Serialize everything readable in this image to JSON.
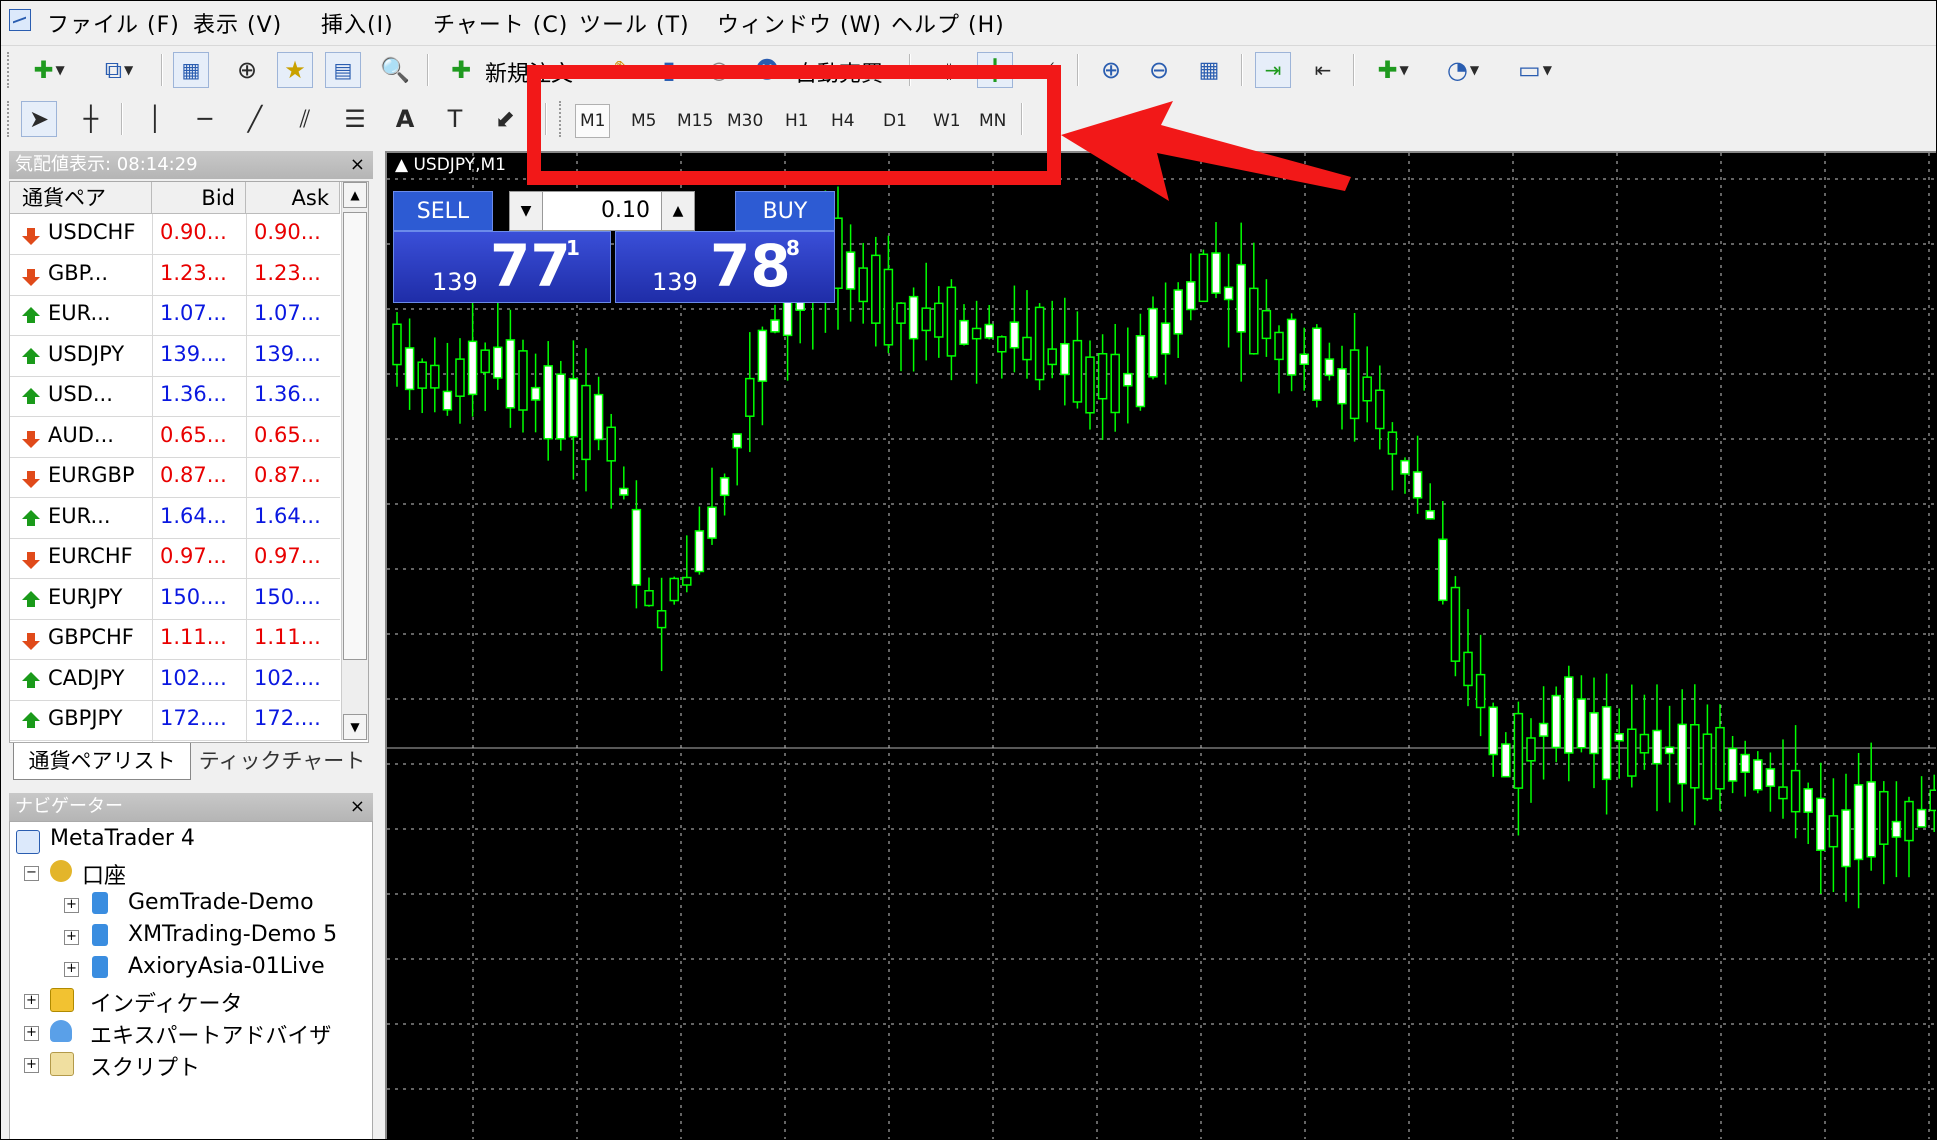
{
  "menu": [
    "ファイル (F)",
    "表示 (V)",
    "挿入(I)",
    "チャート (C)",
    "ツール (T)",
    "ウィンドウ (W)",
    "ヘルプ (H)"
  ],
  "toolbar": {
    "new_order": "新規注文",
    "autotrade": "自動売買"
  },
  "periods": [
    "M1",
    "M5",
    "M15",
    "M30",
    "H1",
    "H4",
    "D1",
    "W1",
    "MN"
  ],
  "active_period": "M1",
  "market_watch": {
    "title": "気配値表示: 08:14:29",
    "col_symbol": "通貨ペア",
    "col_bid": "Bid",
    "col_ask": "Ask",
    "rows": [
      {
        "symbol": "USDCHF",
        "bid": "0.90...",
        "ask": "0.90...",
        "dir": "down"
      },
      {
        "symbol": "GBP...",
        "bid": "1.23...",
        "ask": "1.23...",
        "dir": "down"
      },
      {
        "symbol": "EUR...",
        "bid": "1.07...",
        "ask": "1.07...",
        "dir": "up"
      },
      {
        "symbol": "USDJPY",
        "bid": "139....",
        "ask": "139....",
        "dir": "up"
      },
      {
        "symbol": "USD...",
        "bid": "1.36...",
        "ask": "1.36...",
        "dir": "up"
      },
      {
        "symbol": "AUD...",
        "bid": "0.65...",
        "ask": "0.65...",
        "dir": "down"
      },
      {
        "symbol": "EURGBP",
        "bid": "0.87...",
        "ask": "0.87...",
        "dir": "down"
      },
      {
        "symbol": "EUR...",
        "bid": "1.64...",
        "ask": "1.64...",
        "dir": "up"
      },
      {
        "symbol": "EURCHF",
        "bid": "0.97...",
        "ask": "0.97...",
        "dir": "down"
      },
      {
        "symbol": "EURJPY",
        "bid": "150....",
        "ask": "150....",
        "dir": "up"
      },
      {
        "symbol": "GBPCHF",
        "bid": "1.11...",
        "ask": "1.11...",
        "dir": "down"
      },
      {
        "symbol": "CADJPY",
        "bid": "102....",
        "ask": "102....",
        "dir": "up"
      },
      {
        "symbol": "GBPJPY",
        "bid": "172....",
        "ask": "172....",
        "dir": "up"
      }
    ],
    "tab_symbols": "通貨ペアリスト",
    "tab_tick": "ティックチャート"
  },
  "navigator": {
    "title": "ナビゲーター",
    "root": "MetaTrader 4",
    "accounts": "口座",
    "account_list": [
      "GemTrade-Demo",
      "XMTrading-Demo 5",
      "AxioryAsia-01Live"
    ],
    "indicators": "インディケータ",
    "experts": "エキスパートアドバイザ",
    "scripts": "スクリプト"
  },
  "chart": {
    "title": "USDJPY,M1",
    "sell_label": "SELL",
    "buy_label": "BUY",
    "lot": "0.10",
    "sell_prefix": "139",
    "sell_big": "77",
    "sell_sup": "1",
    "buy_prefix": "139",
    "buy_big": "78",
    "buy_sup": "8"
  },
  "colors": {
    "candle": "#00ff00",
    "bid_up": "#0a18e0",
    "bid_down": "#e80000",
    "annotation": "#f21818"
  }
}
